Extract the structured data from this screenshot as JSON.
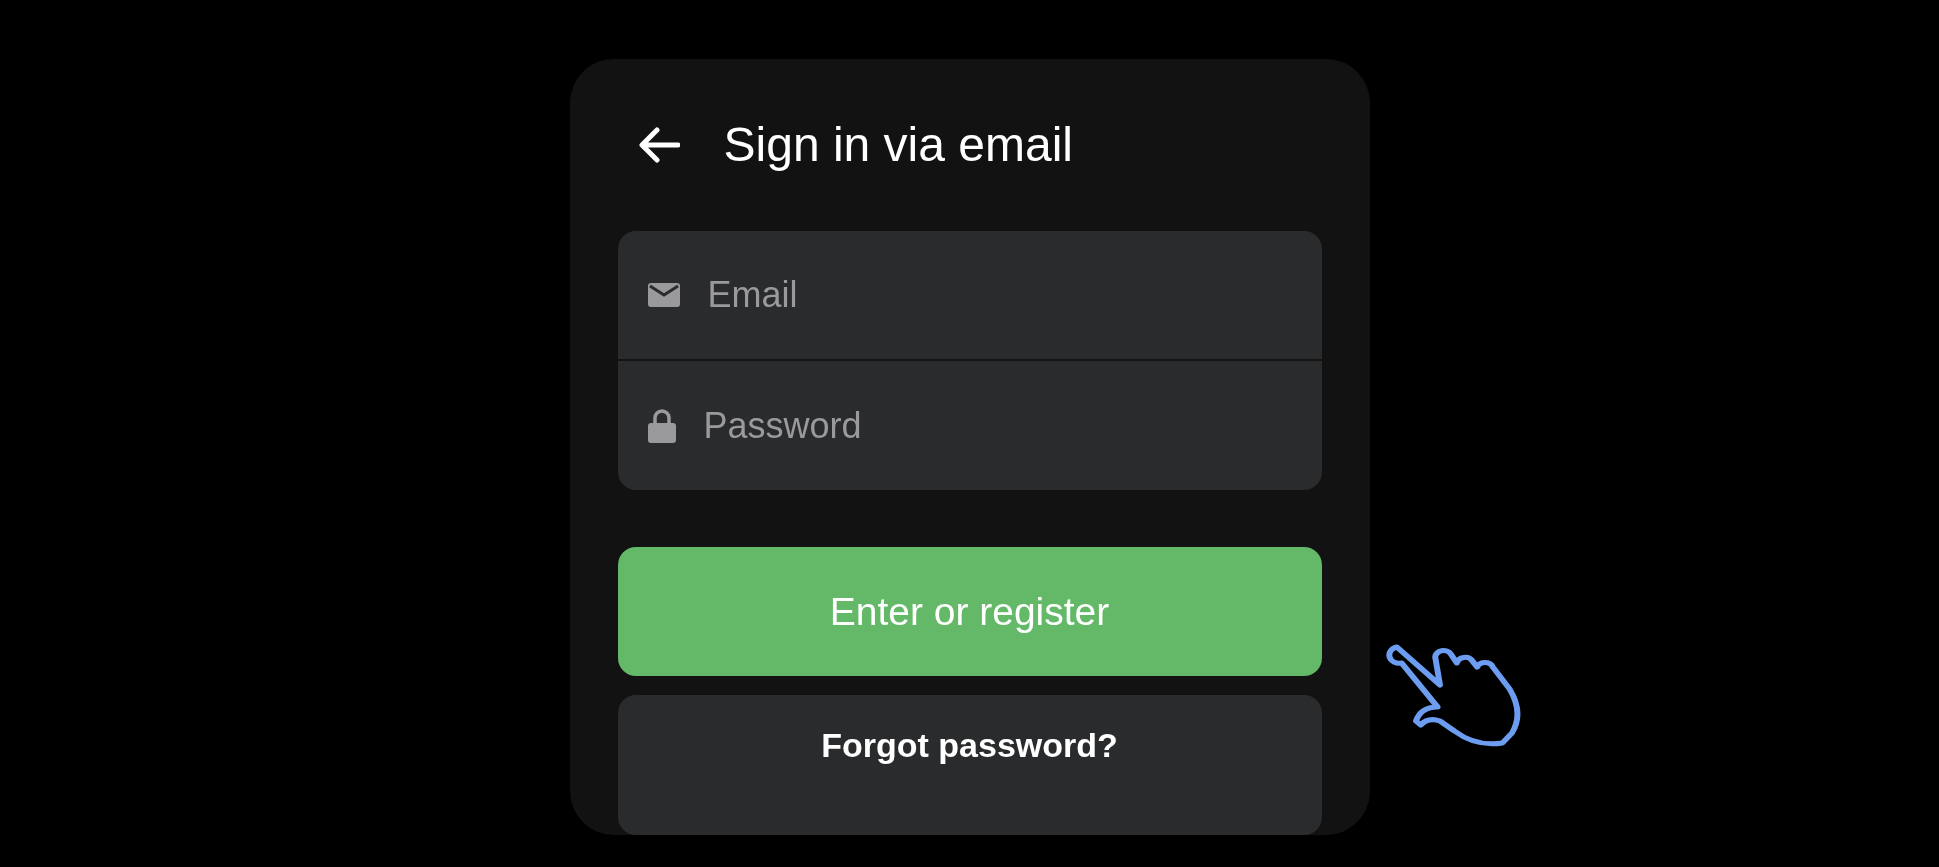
{
  "header": {
    "title": "Sign in via email"
  },
  "fields": [
    {
      "kind": "email",
      "placeholder": "Email"
    },
    {
      "kind": "password",
      "placeholder": "Password"
    }
  ],
  "primary_button": {
    "label": "Enter or register"
  },
  "secondary_button": {
    "label": "Forgot password?"
  }
}
